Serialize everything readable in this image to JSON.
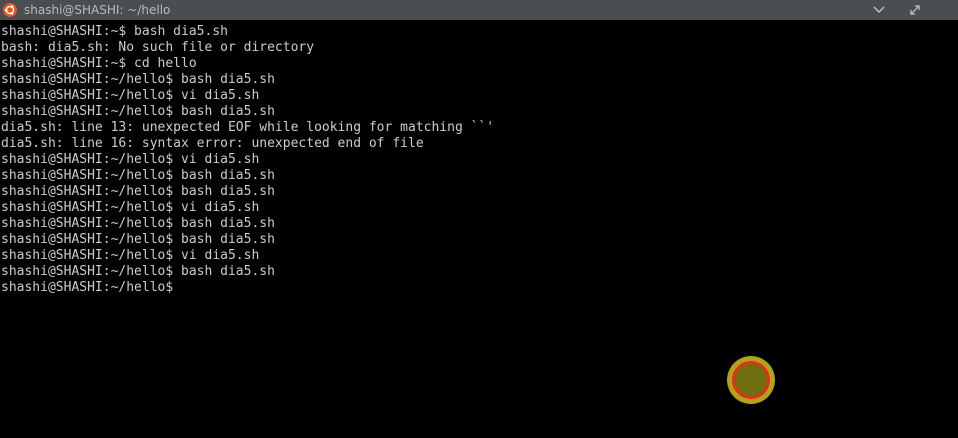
{
  "window": {
    "title": "shashi@SHASHI: ~/hello",
    "icon": "ubuntu-icon",
    "chevron_icon": "chevron-down-icon",
    "maximize_icon": "maximize-icon"
  },
  "terminal": {
    "lines": [
      "shashi@SHASHI:~$ bash dia5.sh",
      "bash: dia5.sh: No such file or directory",
      "shashi@SHASHI:~$ cd hello",
      "shashi@SHASHI:~/hello$ bash dia5.sh",
      "shashi@SHASHI:~/hello$ vi dia5.sh",
      "shashi@SHASHI:~/hello$ bash dia5.sh",
      "dia5.sh: line 13: unexpected EOF while looking for matching ``'",
      "dia5.sh: line 16: syntax error: unexpected end of file",
      "shashi@SHASHI:~/hello$ vi dia5.sh",
      "shashi@SHASHI:~/hello$ bash dia5.sh",
      "shashi@SHASHI:~/hello$ bash dia5.sh",
      "shashi@SHASHI:~/hello$ vi dia5.sh",
      "shashi@SHASHI:~/hello$ bash dia5.sh",
      "shashi@SHASHI:~/hello$ bash dia5.sh",
      "shashi@SHASHI:~/hello$ vi dia5.sh",
      "shashi@SHASHI:~/hello$ bash dia5.sh",
      "shashi@SHASHI:~/hello$"
    ]
  },
  "colors": {
    "background": "#000000",
    "text": "#cccccc",
    "titlebar": "#4a4d52",
    "cursor_ring": "#e0301e",
    "cursor_fill": "#b3a21a"
  }
}
